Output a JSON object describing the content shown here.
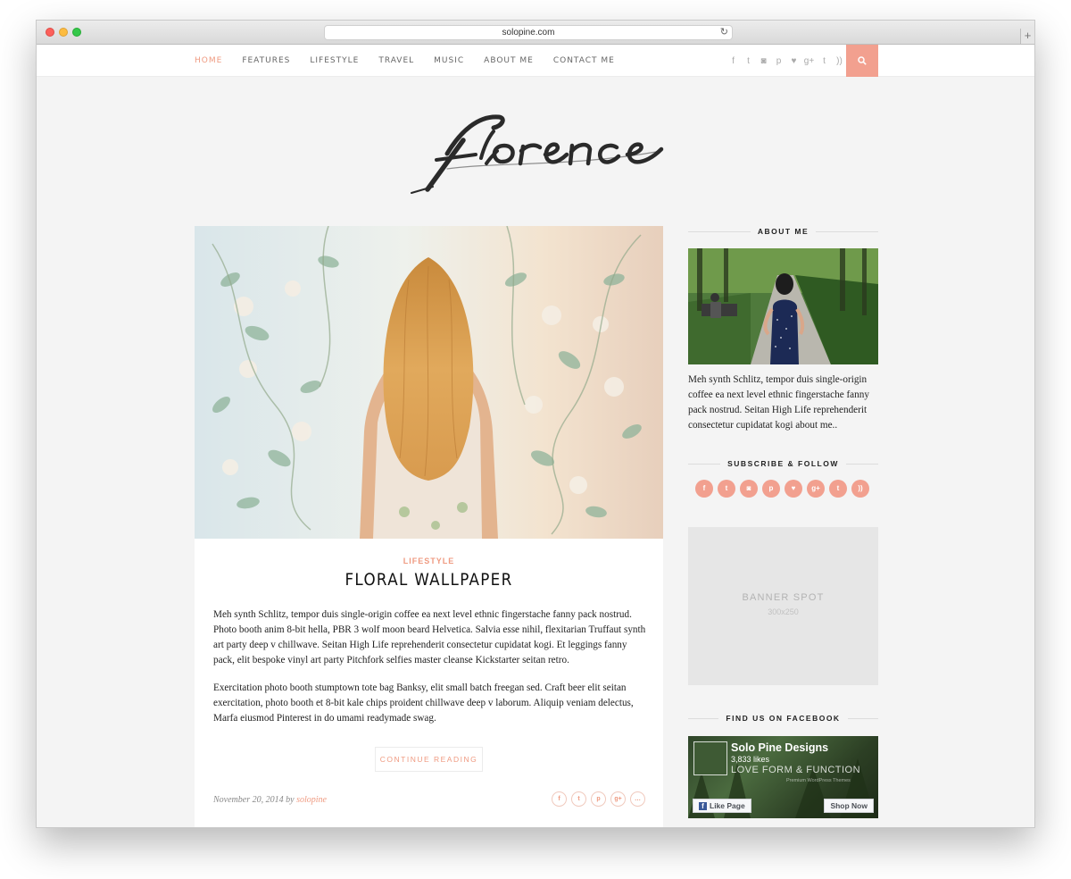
{
  "browser": {
    "url": "solopine.com"
  },
  "nav": {
    "items": [
      "HOME",
      "FEATURES",
      "LIFESTYLE",
      "TRAVEL",
      "MUSIC",
      "ABOUT ME",
      "CONTACT ME"
    ],
    "active": "HOME",
    "social_icons": [
      "facebook-icon",
      "twitter-icon",
      "instagram-icon",
      "pinterest-icon",
      "bloglovin-heart-icon",
      "google-plus-icon",
      "tumblr-icon",
      "rss-icon"
    ]
  },
  "site": {
    "logo_text": "florence"
  },
  "post": {
    "category": "LIFESTYLE",
    "title": "FLORAL WALLPAPER",
    "paragraphs": [
      "Meh synth Schlitz, tempor duis single-origin coffee ea next level ethnic fingerstache fanny pack nostrud. Photo booth anim 8-bit hella, PBR 3 wolf moon beard Helvetica. Salvia esse nihil, flexitarian Truffaut synth art party deep v chillwave. Seitan High Life reprehenderit consectetur cupidatat kogi. Et leggings fanny pack, elit bespoke vinyl art party Pitchfork selfies master cleanse Kickstarter seitan retro.",
      "Exercitation photo booth stumptown tote bag Banksy, elit small batch freegan sed. Craft beer elit seitan exercitation, photo booth et 8-bit kale chips proident chillwave deep v laborum. Aliquip veniam delectus, Marfa eiusmod Pinterest in do umami readymade swag."
    ],
    "continue_label": "CONTINUE READING",
    "date": "November 20, 2014",
    "by": "by",
    "author": "solopine",
    "share_icons": [
      "facebook-icon",
      "twitter-icon",
      "pinterest-icon",
      "google-plus-icon",
      "comment-icon"
    ]
  },
  "sidebar": {
    "about_title": "ABOUT ME",
    "about_text": "Meh synth Schlitz, tempor duis single-origin coffee ea next level ethnic fingerstache fanny pack nostrud. Seitan High Life reprehenderit consectetur cupidatat kogi about me..",
    "follow_title": "SUBSCRIBE & FOLLOW",
    "banner_label": "BANNER SPOT",
    "banner_size": "300x250",
    "facebook_title": "FIND US ON FACEBOOK",
    "fb": {
      "page_name": "Solo Pine Designs",
      "likes": "3,833 likes",
      "tagline": "LOVE FORM & FUNCTION",
      "sub": "Premium WordPress Themes",
      "like_label": "Like Page",
      "shop_label": "Shop Now"
    }
  },
  "colors": {
    "accent": "#f2a08f",
    "background": "#f4f4f4"
  }
}
